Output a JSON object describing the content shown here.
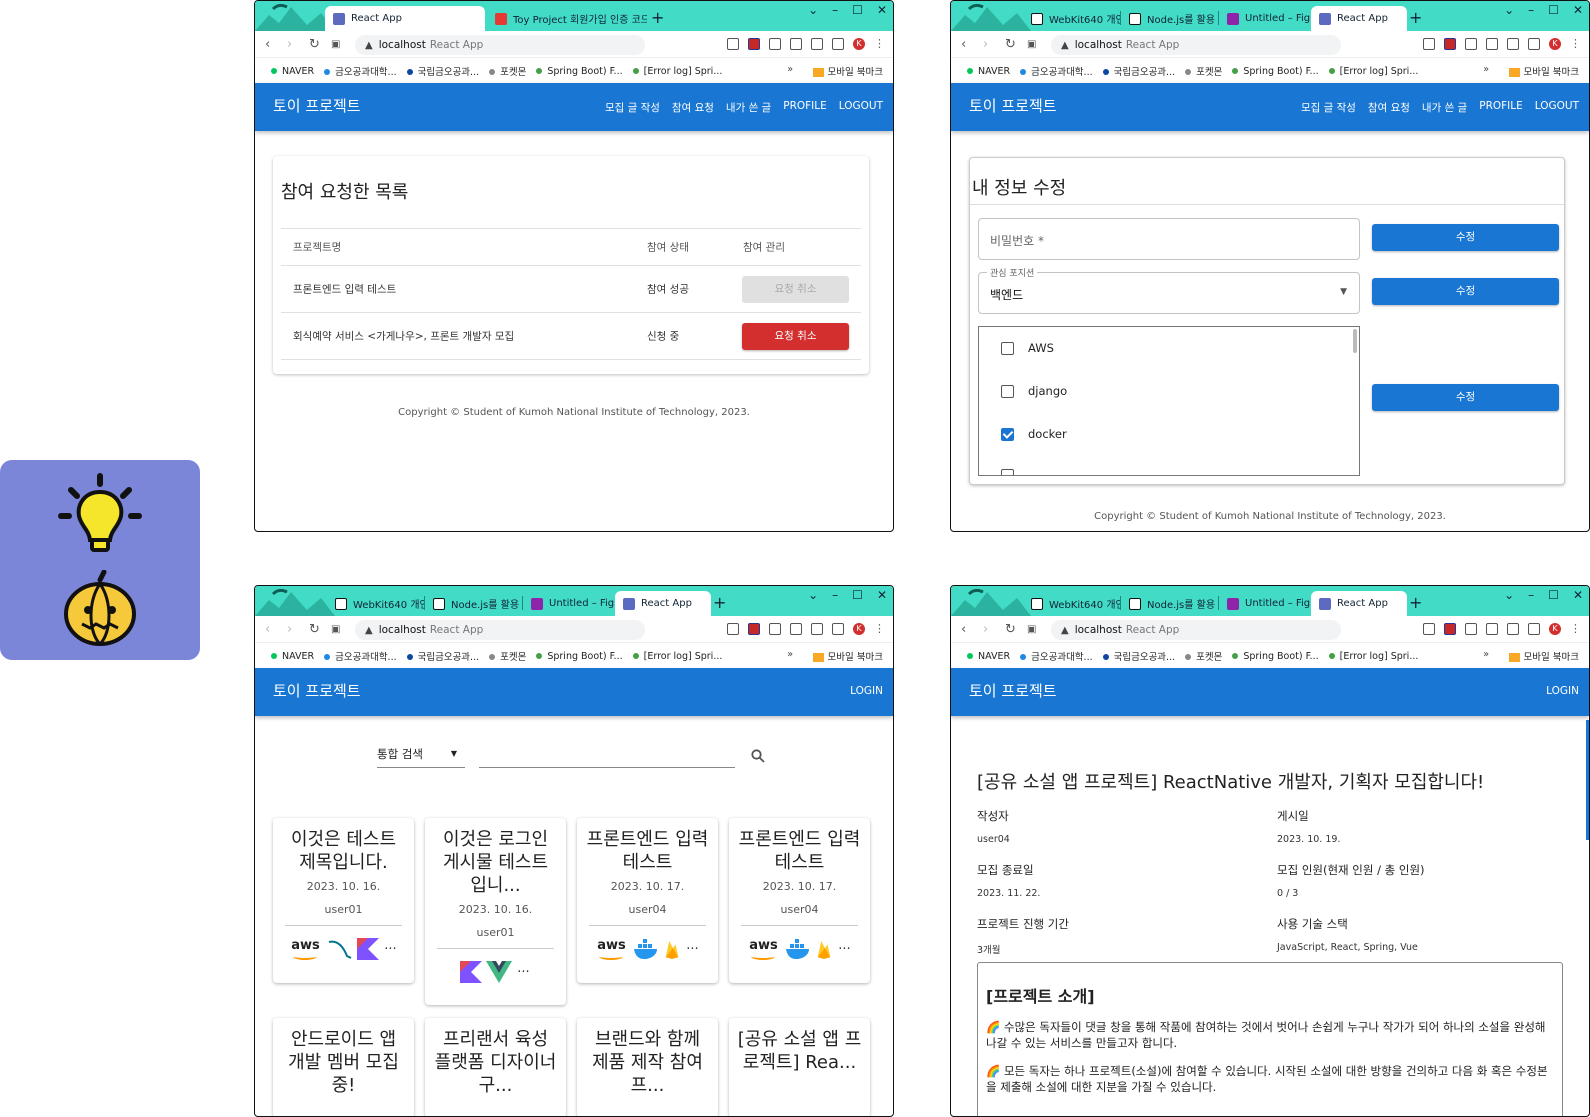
{
  "colors": {
    "primary": "#1976d2",
    "danger": "#d32f2f",
    "tabstrip": "#42dcc6",
    "tile": "#7b86d8"
  },
  "side_tile": {
    "icons": [
      "lightbulb-icon",
      "pumpkin-icon"
    ]
  },
  "browser": {
    "url_host": "localhost",
    "url_title": "React App",
    "bookmarks": [
      "NAVER",
      "금오공과대학...",
      "국립금오공과...",
      "포켓몬",
      "Spring Boot) F...",
      "[Error log] Spri..."
    ],
    "bookmarks_more": "»",
    "bookmark_folder": "모바일 북마크",
    "profile_initial": "K"
  },
  "app": {
    "brand": "토이 프로젝트",
    "copyright": "Copyright © Student of Kumoh National Institute of Technology, 2023."
  },
  "windows": {
    "w1": {
      "tabs": [
        "React App",
        "Toy Project 회원가입 인증 코드"
      ],
      "menu": [
        "모집 글 작성",
        "참여 요청",
        "내가 쓴 글",
        "PROFILE",
        "LOGOUT"
      ],
      "heading": "참여 요청한 목록",
      "columns": [
        "프로젝트명",
        "참여 상태",
        "참여 관리"
      ],
      "rows": [
        {
          "name": "프론트엔드 입력 테스트",
          "status": "참여 성공",
          "action": "요청 취소"
        },
        {
          "name": "회식예약 서비스 <가게나우>, 프론트 개발자 모집",
          "status": "신청 중",
          "action": "요청 취소"
        }
      ]
    },
    "w2": {
      "tabs": [
        "WebKit640 개인",
        "Node.js를 활용",
        "Untitled – Figm",
        "React App"
      ],
      "menu": [
        "모집 글 작성",
        "참여 요청",
        "내가 쓴 글",
        "PROFILE",
        "LOGOUT"
      ],
      "heading": "내 정보 수정",
      "password_placeholder": "비밀번호 *",
      "position_label": "관심 포지션",
      "position_value": "백엔드",
      "submit": "수정",
      "stacks": [
        {
          "name": "AWS",
          "checked": false
        },
        {
          "name": "django",
          "checked": false
        },
        {
          "name": "docker",
          "checked": true
        }
      ]
    },
    "w3": {
      "tabs": [
        "WebKit640 개인",
        "Node.js를 활용",
        "Untitled – Figm",
        "React App"
      ],
      "menu": [
        "LOGIN"
      ],
      "search_type": "통합 검색",
      "search_value": "",
      "cards": [
        {
          "title": "이것은 테스트 제목입니다.",
          "date": "2023. 10. 16.",
          "user": "user01",
          "icons": [
            "aws-icon",
            "mysql-icon",
            "kotlin-icon"
          ]
        },
        {
          "title": "이것은 로그인 게시물 테스트 입니...",
          "date": "2023. 10. 16.",
          "user": "user01",
          "icons": [
            "kotlin-icon",
            "vue-icon"
          ]
        },
        {
          "title": "프론트엔드 입력 테스트",
          "date": "2023. 10. 17.",
          "user": "user04",
          "icons": [
            "aws-icon",
            "docker-icon",
            "firebase-icon"
          ]
        },
        {
          "title": "프론트엔드 입력 테스트",
          "date": "2023. 10. 17.",
          "user": "user04",
          "icons": [
            "aws-icon",
            "docker-icon",
            "firebase-icon"
          ]
        },
        {
          "title": "안드로이드 앱 개발 멤버 모집중!"
        },
        {
          "title": "프리랜서 육성 플랫폼 디자이너 구..."
        },
        {
          "title": "브랜드와 함께 제품 제작 참여 프..."
        },
        {
          "title": "[공유 소설 앱 프로젝트] Rea..."
        }
      ],
      "more": "..."
    },
    "w4": {
      "tabs": [
        "WebKit640 개인",
        "Node.js를 활용",
        "Untitled – Figm",
        "React App"
      ],
      "menu": [
        "LOGIN"
      ],
      "title": "[공유 소설 앱 프로젝트] ReactNative 개발자, 기획자 모집합니다!",
      "fields": [
        {
          "label": "작성자",
          "value": "user04"
        },
        {
          "label": "게시일",
          "value": "2023. 10. 19."
        },
        {
          "label": "모집 종료일",
          "value": "2023. 11. 22."
        },
        {
          "label": "모집 인원(현재 인원 / 총 인원)",
          "value": "0 / 3"
        },
        {
          "label": "프로젝트 진행 기간",
          "value": "3개월"
        },
        {
          "label": "사용 기술 스택",
          "value": "JavaScript, React, Spring, Vue"
        }
      ],
      "intro_heading": "[프로젝트 소개]",
      "intro_paragraphs": [
        "🌈 수많은 독자들이 댓글 창을 통해 작품에 참여하는 것에서 벗어나 손쉽게 누구나 작가가 되어 하나의 소설을 완성해 나갈 수 있는 서비스를 만들고자 합니다.",
        "🌈 모든 독자는 하나 프로젝트(소설)에 참여할 수 있습니다. 시작된 소설에 대한 방향을 건의하고 다음 화 혹은 수정본을 제출해 소설에 대한 지분을 가질 수 있습니다."
      ]
    }
  }
}
